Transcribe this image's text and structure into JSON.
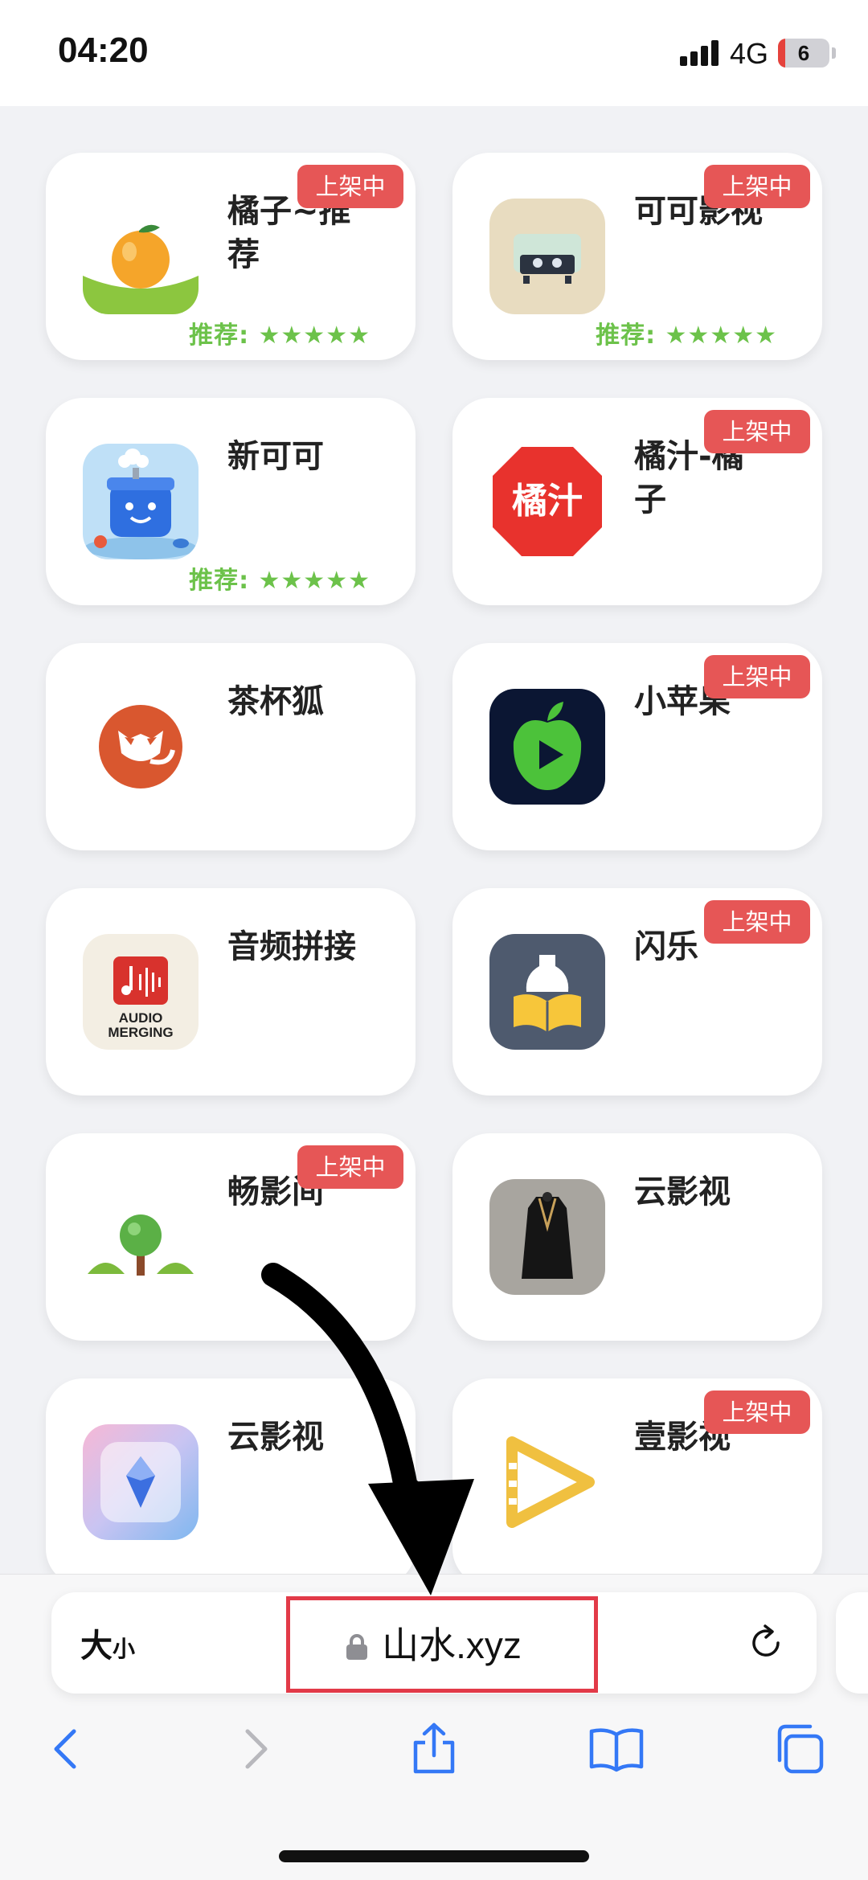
{
  "status_bar": {
    "time": "04:20",
    "network": "4G",
    "battery": "6"
  },
  "apps": [
    {
      "name": "橘子~推荐",
      "badge": "上架中",
      "rating": "推荐: ★★★★★"
    },
    {
      "name": "可可影视",
      "badge": "上架中",
      "rating": "推荐: ★★★★★"
    },
    {
      "name": "新可可",
      "badge": "",
      "rating": "推荐: ★★★★★"
    },
    {
      "name": "橘汁-橘子",
      "badge": "上架中",
      "rating": "",
      "icon_text": "橘汁"
    },
    {
      "name": "茶杯狐",
      "badge": "",
      "rating": ""
    },
    {
      "name": "小苹果",
      "badge": "上架中",
      "rating": ""
    },
    {
      "name": "音频拼接",
      "badge": "",
      "rating": "",
      "icon_text_1": "AUDIO",
      "icon_text_2": "MERGING"
    },
    {
      "name": "闪乐",
      "badge": "上架中",
      "rating": ""
    },
    {
      "name": "畅影间",
      "badge": "上架中",
      "rating": ""
    },
    {
      "name": "云影视",
      "badge": "",
      "rating": ""
    },
    {
      "name": "云影视",
      "badge": "",
      "rating": ""
    },
    {
      "name": "壹影视",
      "badge": "上架中",
      "rating": ""
    }
  ],
  "address_bar": {
    "text_size_big": "大",
    "text_size_small": "小",
    "url": "山水.xyz"
  },
  "toolbar": [
    "back-icon",
    "forward-icon",
    "share-icon",
    "bookmarks-icon",
    "tabs-icon"
  ],
  "colors": {
    "badge": "#e65656",
    "rating": "#6cc24a",
    "accent": "#3478f6",
    "highlight": "#e23a48"
  }
}
